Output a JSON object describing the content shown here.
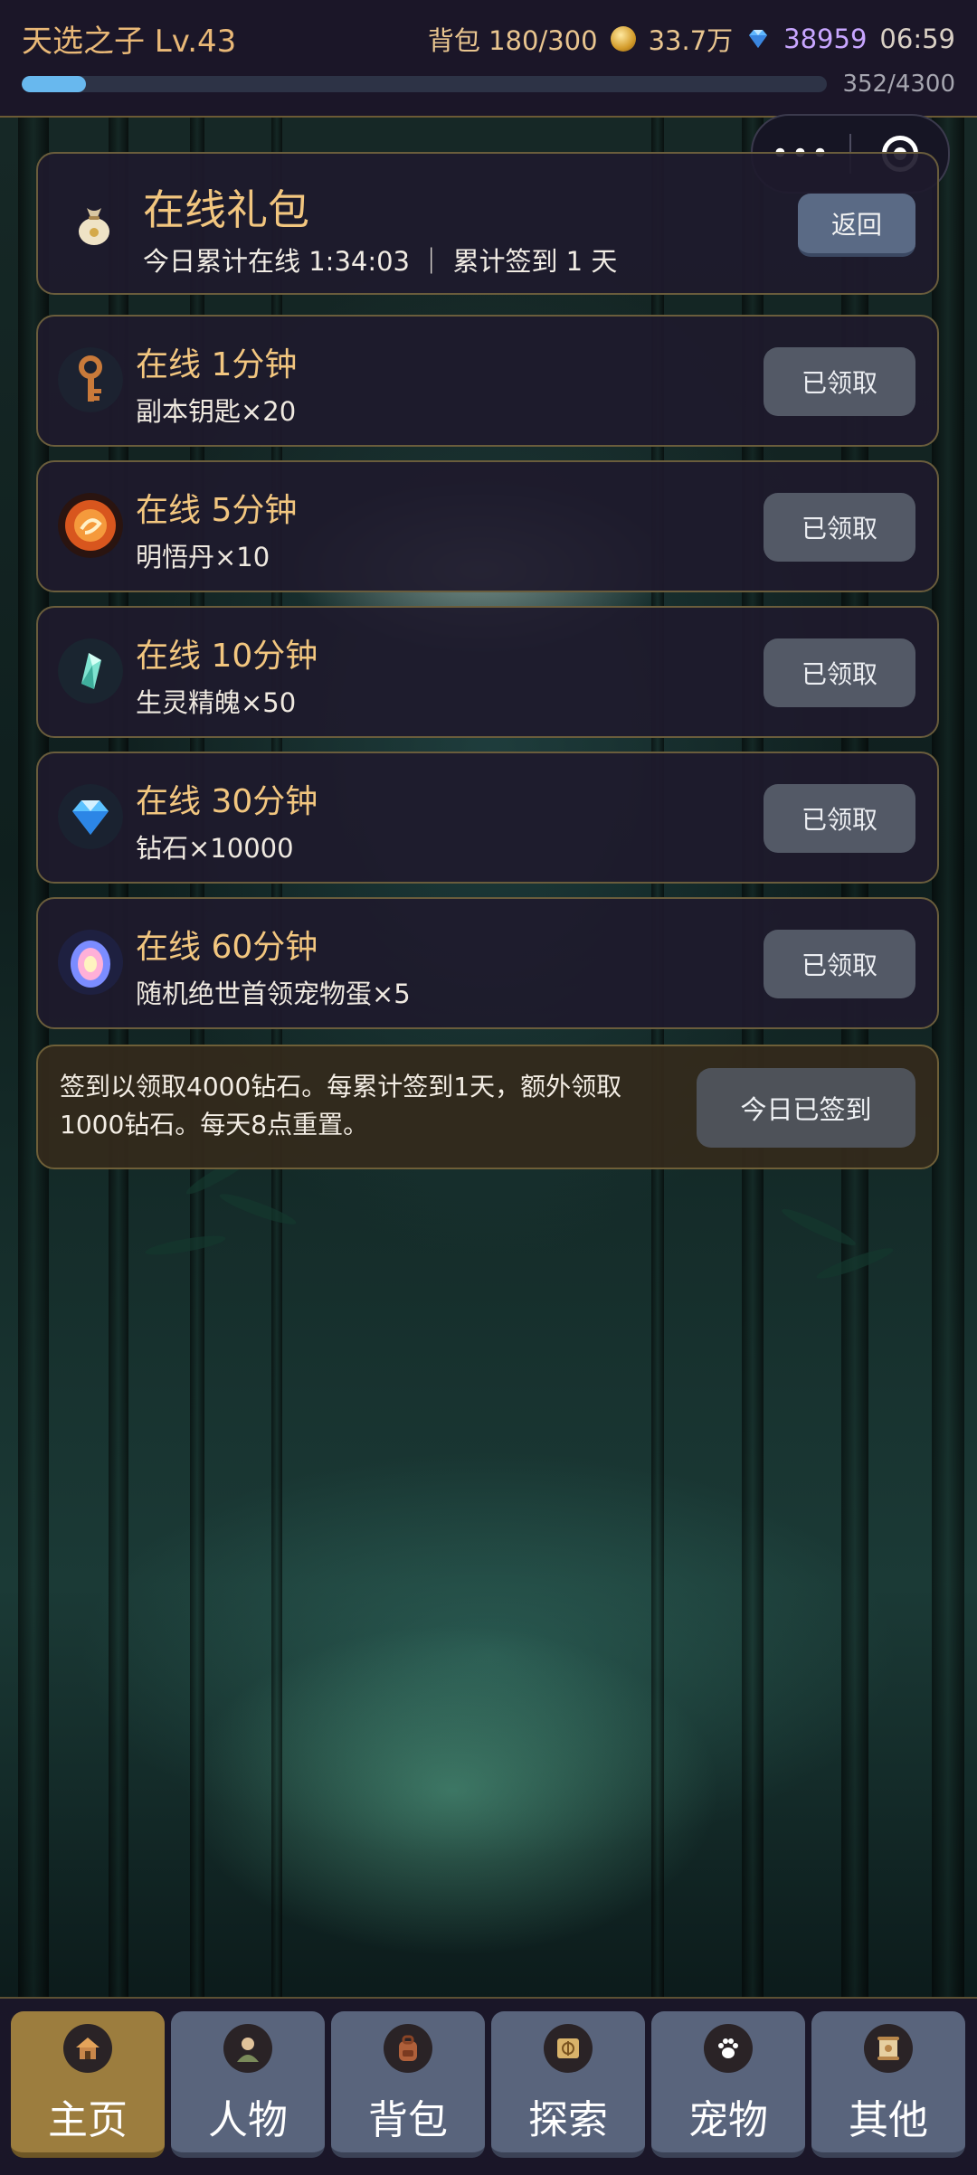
{
  "status": {
    "player_name": "天选之子 Lv.43",
    "bag": "背包 180/300",
    "coins": "33.7万",
    "diamonds": "38959",
    "time": "06:59",
    "exp_text": "352/4300",
    "exp_fraction": 0.08
  },
  "header": {
    "title": "在线礼包",
    "subtitle": "今日累计在线 1:34:03 ｜ 累计签到 1 天",
    "back_label": "返回"
  },
  "capsule": {
    "more": "•••"
  },
  "rewards": [
    {
      "title": "在线 1分钟",
      "desc": "副本钥匙×20",
      "button": "已领取",
      "icon": "key-icon"
    },
    {
      "title": "在线 5分钟",
      "desc": "明悟丹×10",
      "button": "已领取",
      "icon": "orb-icon"
    },
    {
      "title": "在线 10分钟",
      "desc": "生灵精魄×50",
      "button": "已领取",
      "icon": "crystal-icon"
    },
    {
      "title": "在线 30分钟",
      "desc": "钻石×10000",
      "button": "已领取",
      "icon": "diamond-icon"
    },
    {
      "title": "在线 60分钟",
      "desc": "随机绝世首领宠物蛋×5",
      "button": "已领取",
      "icon": "pet-egg-icon"
    }
  ],
  "signin": {
    "text": "签到以领取4000钻石。每累计签到1天，额外领取1000钻石。每天8点重置。",
    "button": "今日已签到"
  },
  "nav": [
    {
      "label": "主页",
      "icon": "home-icon",
      "active": true
    },
    {
      "label": "人物",
      "icon": "character-icon",
      "active": false
    },
    {
      "label": "背包",
      "icon": "backpack-icon",
      "active": false
    },
    {
      "label": "探索",
      "icon": "map-icon",
      "active": false
    },
    {
      "label": "宠物",
      "icon": "paw-icon",
      "active": false
    },
    {
      "label": "其他",
      "icon": "scroll-icon",
      "active": false
    }
  ],
  "colors": {
    "accent_gold": "#f2c67f",
    "exp_bar": "#68b8ee",
    "diamond_text": "#c8a6ff",
    "active_tab": "#9c7d3e",
    "inactive_tab": "#59647c"
  }
}
